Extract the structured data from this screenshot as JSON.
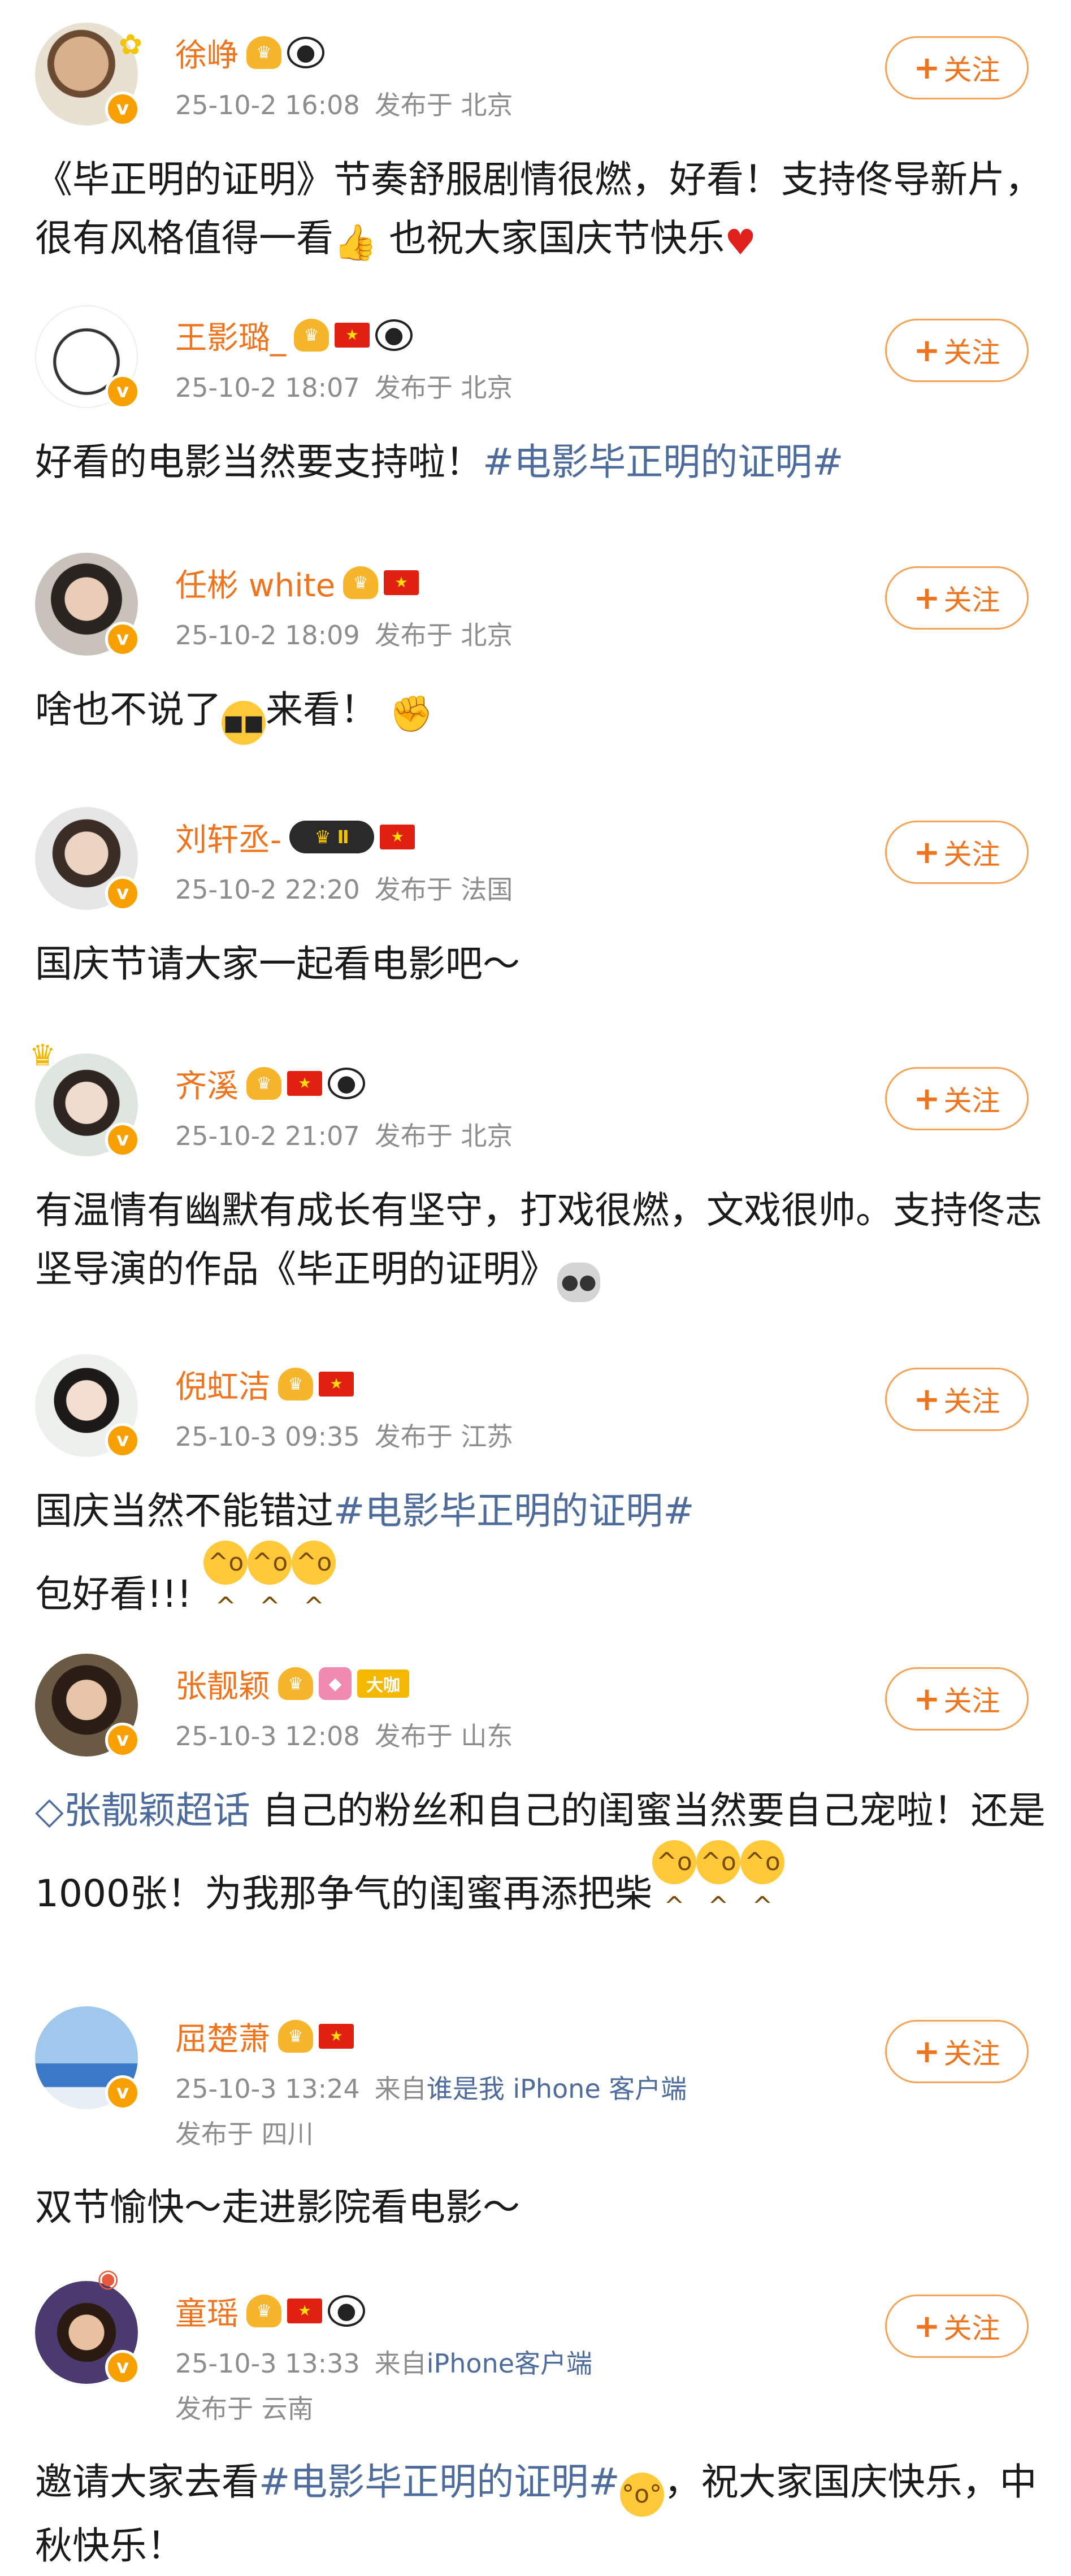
{
  "follow_label": "关注",
  "colors": {
    "name": "#f0741d",
    "meta": "#8d8d8d",
    "topic": "#4d6b9c",
    "follow_border": "#f5a356"
  },
  "posts": [
    {
      "name": "徐峥",
      "date": "25-10-2 16:08",
      "location": "发布于 北京",
      "text_parts": [
        "《毕正明的证明》节奏舒服剧情很燃，好看！支持佟导新片，很有风格值得一看",
        "也祝大家国庆节快乐"
      ]
    },
    {
      "name": "王影璐_",
      "date": "25-10-2 18:07",
      "location": "发布于 北京",
      "text_parts": [
        "好看的电影当然要支持啦！",
        "#电影毕正明的证明#"
      ]
    },
    {
      "name": "任彬 white",
      "date": "25-10-2 18:09",
      "location": "发布于 北京",
      "text_parts": [
        "啥也不说了",
        "来看！"
      ]
    },
    {
      "name": "刘轩丞-",
      "date": "25-10-2 22:20",
      "location": "发布于 法国",
      "text_parts": [
        "国庆节请大家一起看电影吧～"
      ]
    },
    {
      "name": "齐溪",
      "date": "25-10-2 21:07",
      "location": "发布于 北京",
      "text_parts": [
        "有温情有幽默有成长有坚守，打戏很燃，文戏很帅。支持佟志坚导演的作品《毕正明的证明》"
      ]
    },
    {
      "name": "倪虹洁",
      "date": "25-10-3 09:35",
      "location": "发布于 江苏",
      "text_parts": [
        "国庆当然不能错过",
        "#电影毕正明的证明#",
        "包好看!!!"
      ]
    },
    {
      "name": "张靓颖",
      "date": "25-10-3 12:08",
      "location": "发布于 山东",
      "vip_badge": "大咖",
      "text_parts": [
        "张靓颖超话",
        " 自己的粉丝和自己的闺蜜当然要自己宠啦！还是1000张！为我那争气的闺蜜再添把柴"
      ]
    },
    {
      "name": "屈楚萧",
      "date": "25-10-3 13:24",
      "source_prefix": "来自",
      "client": "谁是我 iPhone 客户端",
      "location": "发布于 四川",
      "text_parts": [
        "双节愉快～走进影院看电影～"
      ]
    },
    {
      "name": "童瑶",
      "date": "25-10-3 13:33",
      "source_prefix": "来自",
      "client": "iPhone客户端",
      "location": "发布于 云南",
      "text_parts": [
        "邀请大家去看",
        "#电影毕正明的证明#",
        "，祝大家国庆快乐，中秋快乐！"
      ]
    }
  ]
}
